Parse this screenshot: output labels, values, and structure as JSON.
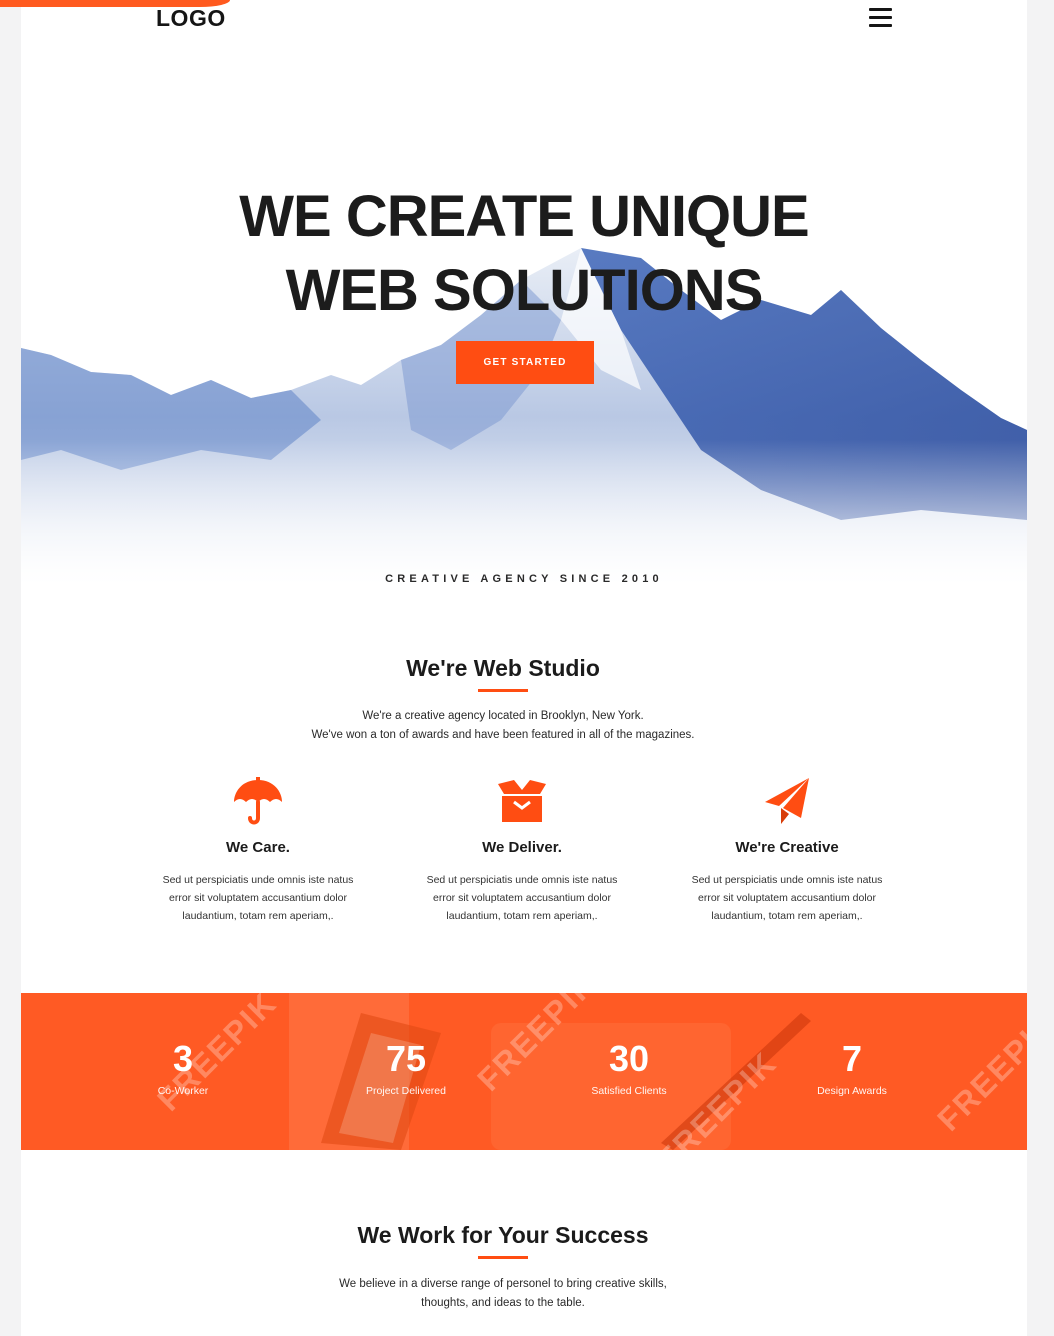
{
  "header": {
    "logo": "LOGO",
    "menu_icon": "hamburger-menu-icon"
  },
  "hero": {
    "title_line1": "WE CREATE UNIQUE",
    "title_line2": "WEB SOLUTIONS",
    "cta_label": "GET STARTED",
    "tagline": "CREATIVE AGENCY SINCE 2010"
  },
  "about": {
    "title": "We're Web Studio",
    "line1": "We're a creative agency located in Brooklyn, New York.",
    "line2": "We've won a ton of awards and have been featured in all of the magazines."
  },
  "features": [
    {
      "icon": "umbrella-icon",
      "title": "We Care.",
      "l1": "Sed ut perspiciatis unde omnis iste natus",
      "l2": "error sit voluptatem accusantium dolor",
      "l3": "laudantium, totam rem aperiam,."
    },
    {
      "icon": "box-icon",
      "title": "We Deliver.",
      "l1": "Sed ut perspiciatis unde omnis iste natus",
      "l2": "error sit voluptatem accusantium dolor",
      "l3": "laudantium, totam rem aperiam,."
    },
    {
      "icon": "paper-plane-icon",
      "title": "We're Creative",
      "l1": "Sed ut perspiciatis unde omnis iste natus",
      "l2": "error sit voluptatem accusantium dolor",
      "l3": "laudantium, totam rem aperiam,."
    }
  ],
  "stats": [
    {
      "number": "3",
      "label": "Co-Worker"
    },
    {
      "number": "75",
      "label": "Project Delivered"
    },
    {
      "number": "30",
      "label": "Satisfied Clients"
    },
    {
      "number": "7",
      "label": "Design Awards"
    }
  ],
  "success": {
    "title": "We Work for Your Success",
    "line1": "We believe in a diverse range of personel to bring creative skills,",
    "line2": "thoughts, and ideas to the table."
  },
  "watermark": "FREEPIK",
  "colors": {
    "accent": "#ff4d12",
    "stats_bg": "#ff5a24",
    "text": "#1c1c1c"
  }
}
